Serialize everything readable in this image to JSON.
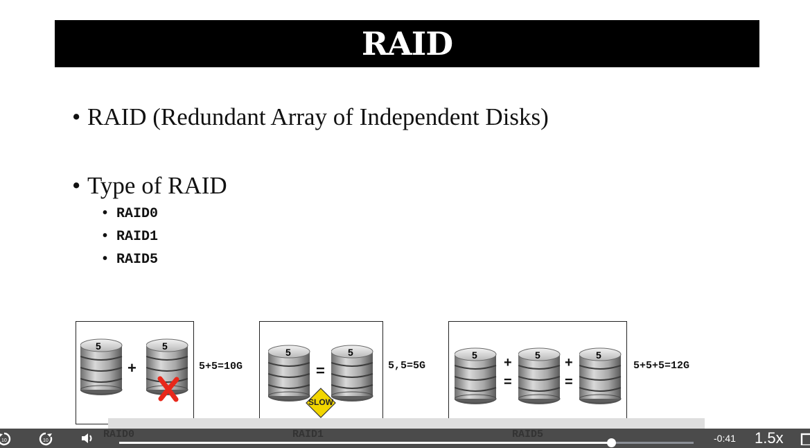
{
  "slide": {
    "title": "RAID",
    "bullet1": "RAID (Redundant Array of Independent Disks)",
    "bullet2": "Type of RAID",
    "sub_items": [
      "RAID0",
      "RAID1",
      "RAID5"
    ],
    "bullet_char": "•"
  },
  "diagrams": {
    "raid0": {
      "disk_label": "5",
      "op": "+",
      "formula": "5+5=10G",
      "caption": "RAID0"
    },
    "raid1": {
      "disk_label": "5",
      "op": "=",
      "badge": "SLOW",
      "formula": "5,5=5G",
      "caption": "RAID1"
    },
    "raid5": {
      "disk_label": "5",
      "op_plus": "+",
      "op_eq": "=",
      "formula": "5+5+5=12G",
      "caption": "RAID5"
    }
  },
  "player": {
    "time_remaining": "-0:41",
    "speed": "1.5x",
    "progress": 0.857,
    "icons": [
      "rewind-10-icon",
      "forward-10-icon",
      "volume-icon",
      "fullscreen-icon"
    ]
  },
  "colors": {
    "badge": "#f2d500",
    "fail_mark": "#e8281b",
    "title_bg": "#000000"
  }
}
